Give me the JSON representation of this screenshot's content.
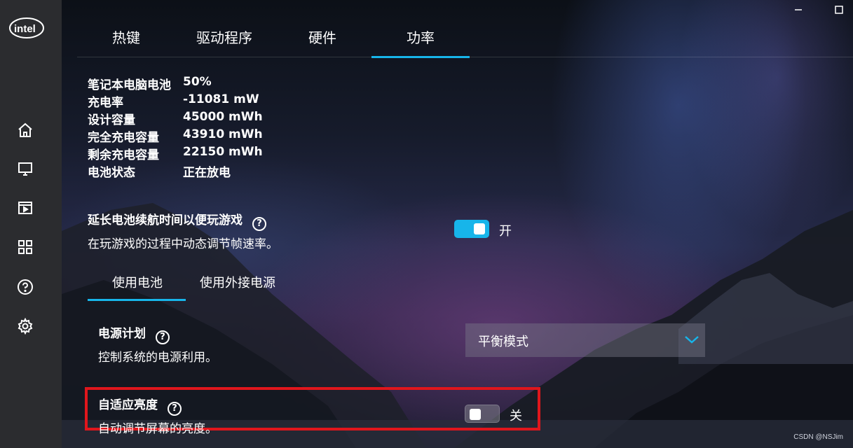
{
  "sidebar": {
    "logo": "intel",
    "icons": [
      "home-icon",
      "display-icon",
      "video-icon",
      "apps-grid-icon",
      "help-icon",
      "settings-gear-icon"
    ]
  },
  "tabs": [
    {
      "label": "热键"
    },
    {
      "label": "驱动程序"
    },
    {
      "label": "硬件"
    },
    {
      "label": "功率",
      "active": true
    }
  ],
  "battery": {
    "rows": [
      {
        "label": "笔记本电脑电池",
        "value": "50%"
      },
      {
        "label": "充电率",
        "value": "-11081 mW"
      },
      {
        "label": "设计容量",
        "value": "45000 mWh"
      },
      {
        "label": "完全充电容量",
        "value": "43910 mWh"
      },
      {
        "label": "剩余充电容量",
        "value": "22150 mWh"
      },
      {
        "label": "电池状态",
        "value": "正在放电"
      }
    ]
  },
  "extend_gaming": {
    "title": "延长电池续航时间以便玩游戏",
    "description": "在玩游戏的过程中动态调节帧速率。",
    "state": "开",
    "on": true
  },
  "power_source_tabs": [
    {
      "label": "使用电池",
      "active": true
    },
    {
      "label": "使用外接电源"
    }
  ],
  "power_plan": {
    "title": "电源计划",
    "description": "控制系统的电源利用。",
    "selected": "平衡模式"
  },
  "adaptive_brightness": {
    "title": "自适应亮度",
    "description": "自动调节屏幕的亮度。",
    "state": "关",
    "on": false
  },
  "help_symbol": "?",
  "watermark": "CSDN @NSJim",
  "colors": {
    "accent": "#17b5ea",
    "highlight": "#e0161c",
    "sidebar": "#2b2c2f"
  }
}
